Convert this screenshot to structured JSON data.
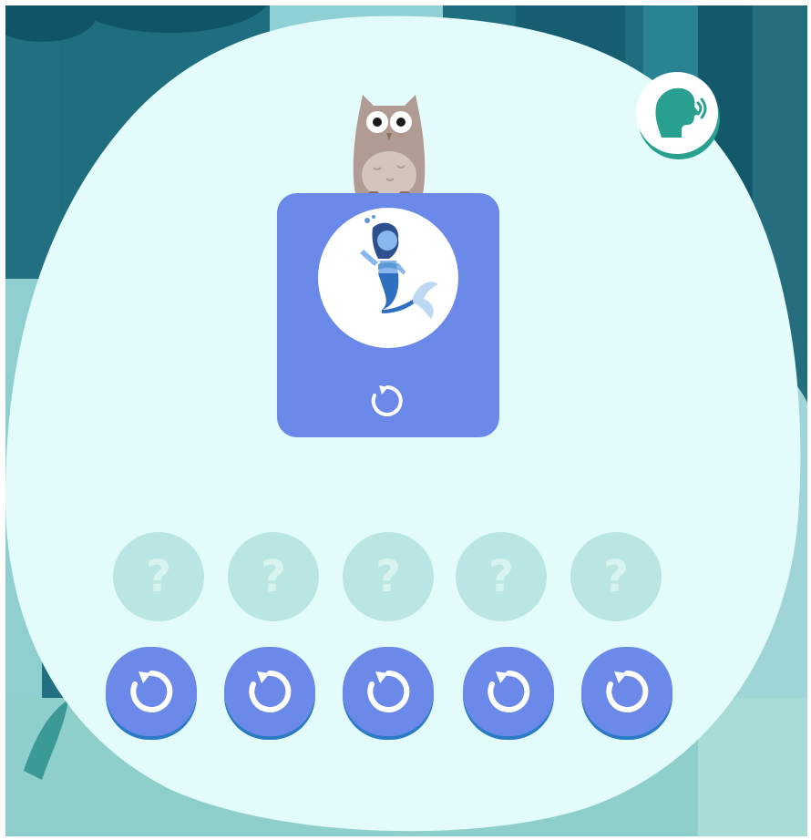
{
  "colors": {
    "background_forest": "#1d6f80",
    "panel": "#e4fbfb",
    "card": "#6a89e8",
    "slot": "#b9e6e3",
    "slot_glyph": "#d7f2ef",
    "button_shadow": "#2b7bc4",
    "speaker_icon": "#2aa091"
  },
  "speaker": {
    "icon": "speaking-head-icon"
  },
  "mascot": {
    "icon": "owl-icon"
  },
  "prompt_card": {
    "image_icon": "mermaid-icon",
    "replay_icon": "replay-icon"
  },
  "answer_slots": [
    {
      "symbol": "?"
    },
    {
      "symbol": "?"
    },
    {
      "symbol": "?"
    },
    {
      "symbol": "?"
    },
    {
      "symbol": "?"
    }
  ],
  "choice_buttons": [
    {
      "icon": "replay-icon"
    },
    {
      "icon": "replay-icon"
    },
    {
      "icon": "replay-icon"
    },
    {
      "icon": "replay-icon"
    },
    {
      "icon": "replay-icon"
    }
  ]
}
